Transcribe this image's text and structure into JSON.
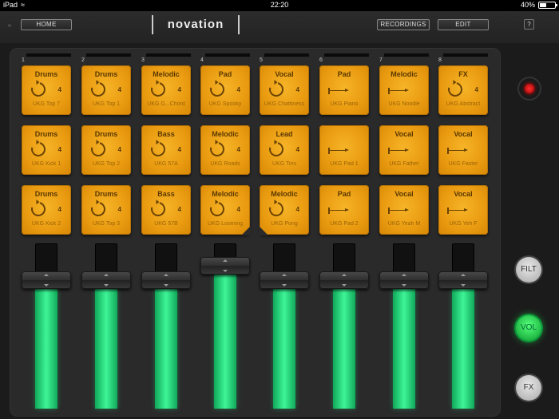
{
  "status": {
    "device": "iPad",
    "time": "22:20",
    "battery": "40%",
    "battery_level": 0.4
  },
  "top": {
    "home": "HOME",
    "brand": "novation",
    "recordings": "RECORDINGS",
    "edit": "EDIT",
    "help": "?"
  },
  "tracks": [
    {
      "num": "1",
      "fader": 0.96,
      "pads": [
        {
          "cat": "Drums",
          "name": "UKG Top 7",
          "count": "4",
          "type": "loop"
        },
        {
          "cat": "Drums",
          "name": "UKG Kick 1",
          "count": "4",
          "type": "loop"
        },
        {
          "cat": "Drums",
          "name": "UKG Kick 2",
          "count": "4",
          "type": "loop"
        }
      ]
    },
    {
      "num": "2",
      "fader": 0.96,
      "pads": [
        {
          "cat": "Drums",
          "name": "UKG Top 1",
          "count": "4",
          "type": "loop"
        },
        {
          "cat": "Drums",
          "name": "UKG Top 2",
          "count": "4",
          "type": "loop"
        },
        {
          "cat": "Drums",
          "name": "UKG Top 3",
          "count": "4",
          "type": "loop"
        }
      ]
    },
    {
      "num": "3",
      "fader": 0.96,
      "pads": [
        {
          "cat": "Melodic",
          "name": "UKG G...Chord",
          "count": "4",
          "type": "loop"
        },
        {
          "cat": "Bass",
          "name": "UKG 57A",
          "count": "4",
          "type": "loop"
        },
        {
          "cat": "Bass",
          "name": "UKG 57B",
          "count": "4",
          "type": "loop"
        }
      ]
    },
    {
      "num": "4",
      "fader": 1.0,
      "pads": [
        {
          "cat": "Pad",
          "name": "UKG Spooky",
          "count": "4",
          "type": "loop"
        },
        {
          "cat": "Melodic",
          "name": "UKG Roads",
          "count": "4",
          "type": "loop"
        },
        {
          "cat": "Melodic",
          "name": "UKG Looming",
          "count": "4",
          "type": "loop",
          "notch": "right"
        }
      ]
    },
    {
      "num": "5",
      "fader": 0.96,
      "pads": [
        {
          "cat": "Vocal",
          "name": "UKG Chattiness",
          "count": "4",
          "type": "loop"
        },
        {
          "cat": "Lead",
          "name": "UKG Tins",
          "count": "4",
          "type": "loop"
        },
        {
          "cat": "Melodic",
          "name": "UKG Pong",
          "count": "4",
          "type": "loop",
          "notch": "left"
        }
      ]
    },
    {
      "num": "6",
      "fader": 0.96,
      "pads": [
        {
          "cat": "Pad",
          "name": "UKG Piano",
          "count": "",
          "type": "oneshot"
        },
        {
          "cat": "",
          "name": "UKG Pad 1",
          "count": "",
          "type": "oneshot"
        },
        {
          "cat": "Pad",
          "name": "UKG Pad 2",
          "count": "",
          "type": "oneshot"
        }
      ]
    },
    {
      "num": "7",
      "fader": 0.96,
      "pads": [
        {
          "cat": "Melodic",
          "name": "UKG Noodle",
          "count": "",
          "type": "oneshot"
        },
        {
          "cat": "Vocal",
          "name": "UKG Father",
          "count": "",
          "type": "oneshot"
        },
        {
          "cat": "Vocal",
          "name": "UKG Yeah M",
          "count": "",
          "type": "oneshot"
        }
      ]
    },
    {
      "num": "8",
      "fader": 0.96,
      "pads": [
        {
          "cat": "FX",
          "name": "UKG Abstract",
          "count": "4",
          "type": "loop"
        },
        {
          "cat": "Vocal",
          "name": "UKG Faster",
          "count": "",
          "type": "oneshot"
        },
        {
          "cat": "Vocal",
          "name": "UKG Yeh F",
          "count": "",
          "type": "oneshot"
        }
      ]
    }
  ],
  "side": {
    "filt": "FILT",
    "vol": "VOL",
    "fx": "FX"
  }
}
